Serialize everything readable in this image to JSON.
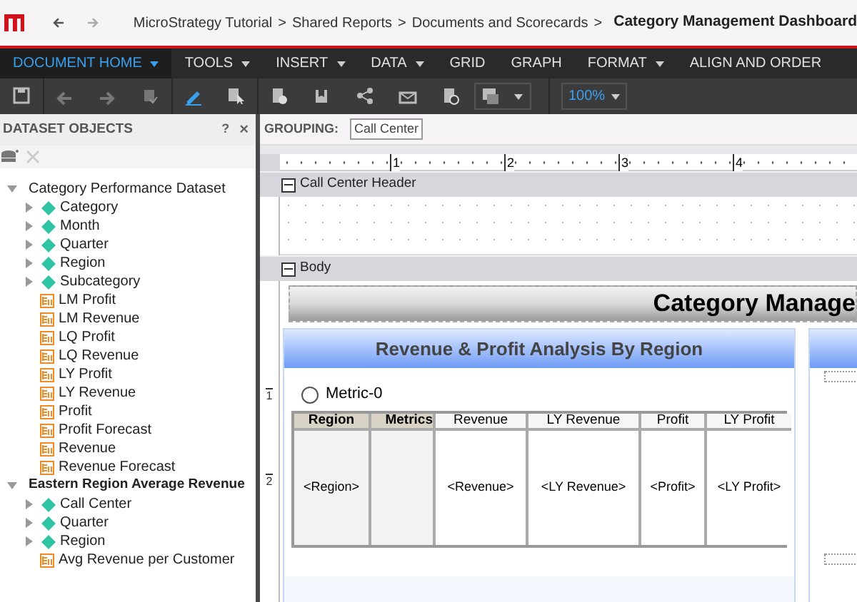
{
  "breadcrumb": [
    {
      "label": "MicroStrategy Tutorial",
      "current": false
    },
    {
      "label": "Shared Reports",
      "current": false
    },
    {
      "label": "Documents and Scorecards",
      "current": false
    },
    {
      "label": "Category Management Dashboard",
      "current": true
    }
  ],
  "breadcrumb_separator": ">",
  "menu": [
    {
      "label": "DOCUMENT HOME",
      "selected": true,
      "dropdown": true
    },
    {
      "label": "TOOLS",
      "selected": false,
      "dropdown": true
    },
    {
      "label": "INSERT",
      "selected": false,
      "dropdown": true
    },
    {
      "label": "DATA",
      "selected": false,
      "dropdown": true
    },
    {
      "label": "GRID",
      "selected": false,
      "dropdown": false
    },
    {
      "label": "GRAPH",
      "selected": false,
      "dropdown": false
    },
    {
      "label": "FORMAT",
      "selected": false,
      "dropdown": true
    },
    {
      "label": "ALIGN AND ORDER",
      "selected": false,
      "dropdown": false
    }
  ],
  "zoom": {
    "value": "100%"
  },
  "sidebar": {
    "title": "DATASET OBJECTS",
    "help": "?",
    "close": "×",
    "tree": [
      {
        "label": "Category Performance Dataset",
        "expanded": true,
        "bold": false,
        "children": [
          {
            "label": "Category",
            "kind": "attribute",
            "expanded": false
          },
          {
            "label": "Month",
            "kind": "attribute",
            "expanded": false
          },
          {
            "label": "Quarter",
            "kind": "attribute",
            "expanded": false
          },
          {
            "label": "Region",
            "kind": "attribute",
            "expanded": false
          },
          {
            "label": "Subcategory",
            "kind": "attribute",
            "expanded": false
          },
          {
            "label": "LM Profit",
            "kind": "metric"
          },
          {
            "label": "LM Revenue",
            "kind": "metric"
          },
          {
            "label": "LQ Profit",
            "kind": "metric"
          },
          {
            "label": "LQ Revenue",
            "kind": "metric"
          },
          {
            "label": "LY Profit",
            "kind": "metric"
          },
          {
            "label": "LY Revenue",
            "kind": "metric"
          },
          {
            "label": "Profit",
            "kind": "metric"
          },
          {
            "label": "Profit Forecast",
            "kind": "metric"
          },
          {
            "label": "Revenue",
            "kind": "metric"
          },
          {
            "label": "Revenue Forecast",
            "kind": "metric"
          }
        ]
      },
      {
        "label": "Eastern Region Average Revenue",
        "expanded": true,
        "bold": true,
        "children": [
          {
            "label": "Call Center",
            "kind": "attribute",
            "expanded": false
          },
          {
            "label": "Quarter",
            "kind": "attribute",
            "expanded": false
          },
          {
            "label": "Region",
            "kind": "attribute",
            "expanded": false
          },
          {
            "label": "Avg Revenue per Customer",
            "kind": "metric"
          }
        ]
      }
    ]
  },
  "grouping": {
    "label": "GROUPING:",
    "items": [
      "Call Center"
    ]
  },
  "ruler": {
    "marks": [
      "1",
      "2",
      "3",
      "4"
    ],
    "vertical_marks": [
      "1",
      "2"
    ]
  },
  "sections": [
    {
      "label": "Call Center Header",
      "expanded": true
    },
    {
      "label": "Body",
      "expanded": true
    }
  ],
  "title_banner": "Category Manage",
  "panel": {
    "title": "Revenue & Profit Analysis By Region",
    "selector": {
      "label": "Metric-0",
      "selected": false
    },
    "grid": {
      "columns": [
        {
          "label": "Region",
          "kind": "axis",
          "cell": "<Region>"
        },
        {
          "label": "Metrics",
          "kind": "axis"
        },
        {
          "label": "Revenue",
          "kind": "metric",
          "cell": "<Revenue>"
        },
        {
          "label": "LY Revenue",
          "kind": "metric",
          "cell": "<LY Revenue>"
        },
        {
          "label": "Profit",
          "kind": "metric",
          "cell": "<Profit>"
        },
        {
          "label": "LY Profit",
          "kind": "metric",
          "cell": "<LY Profit>"
        }
      ]
    }
  }
}
